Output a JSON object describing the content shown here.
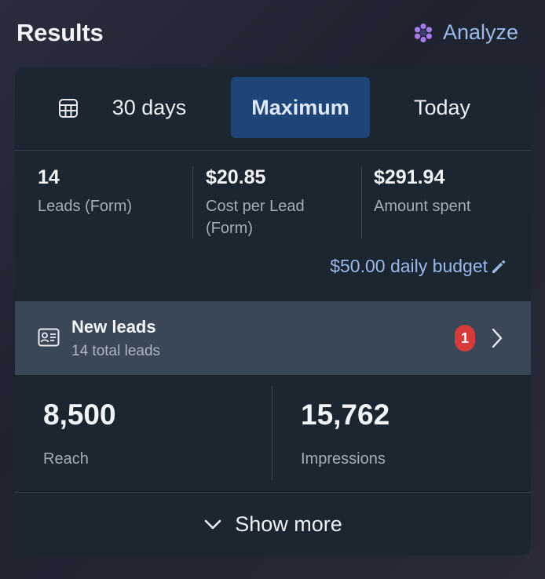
{
  "header": {
    "title": "Results",
    "analyze_label": "Analyze"
  },
  "range": {
    "options": [
      {
        "label": "30 days"
      },
      {
        "label": "Maximum",
        "selected": true
      },
      {
        "label": "Today"
      }
    ]
  },
  "metrics": [
    {
      "value": "14",
      "label": "Leads (Form)"
    },
    {
      "value": "$20.85",
      "label": "Cost per Lead (Form)"
    },
    {
      "value": "$291.94",
      "label": "Amount spent"
    }
  ],
  "budget": {
    "label": "$50.00 daily budget"
  },
  "leads": {
    "title": "New leads",
    "subtitle": "14 total leads",
    "badge": "1"
  },
  "stats": [
    {
      "value": "8,500",
      "label": "Reach"
    },
    {
      "value": "15,762",
      "label": "Impressions"
    }
  ],
  "show_more": {
    "label": "Show more"
  },
  "colors": {
    "accent": "#9ab8e8",
    "selected_bg": "#1d4577",
    "card_bg": "#1b2631",
    "leads_bg": "#3a4757",
    "badge": "#d63a3a",
    "analyze_icon": "#a67bea"
  },
  "icons": {
    "analyze": "sparkle-flower-icon",
    "calendar": "calendar-icon",
    "edit": "pencil-icon",
    "lead": "contact-card-icon",
    "chevron_right": "chevron-right-icon",
    "chevron_down": "chevron-down-icon"
  }
}
